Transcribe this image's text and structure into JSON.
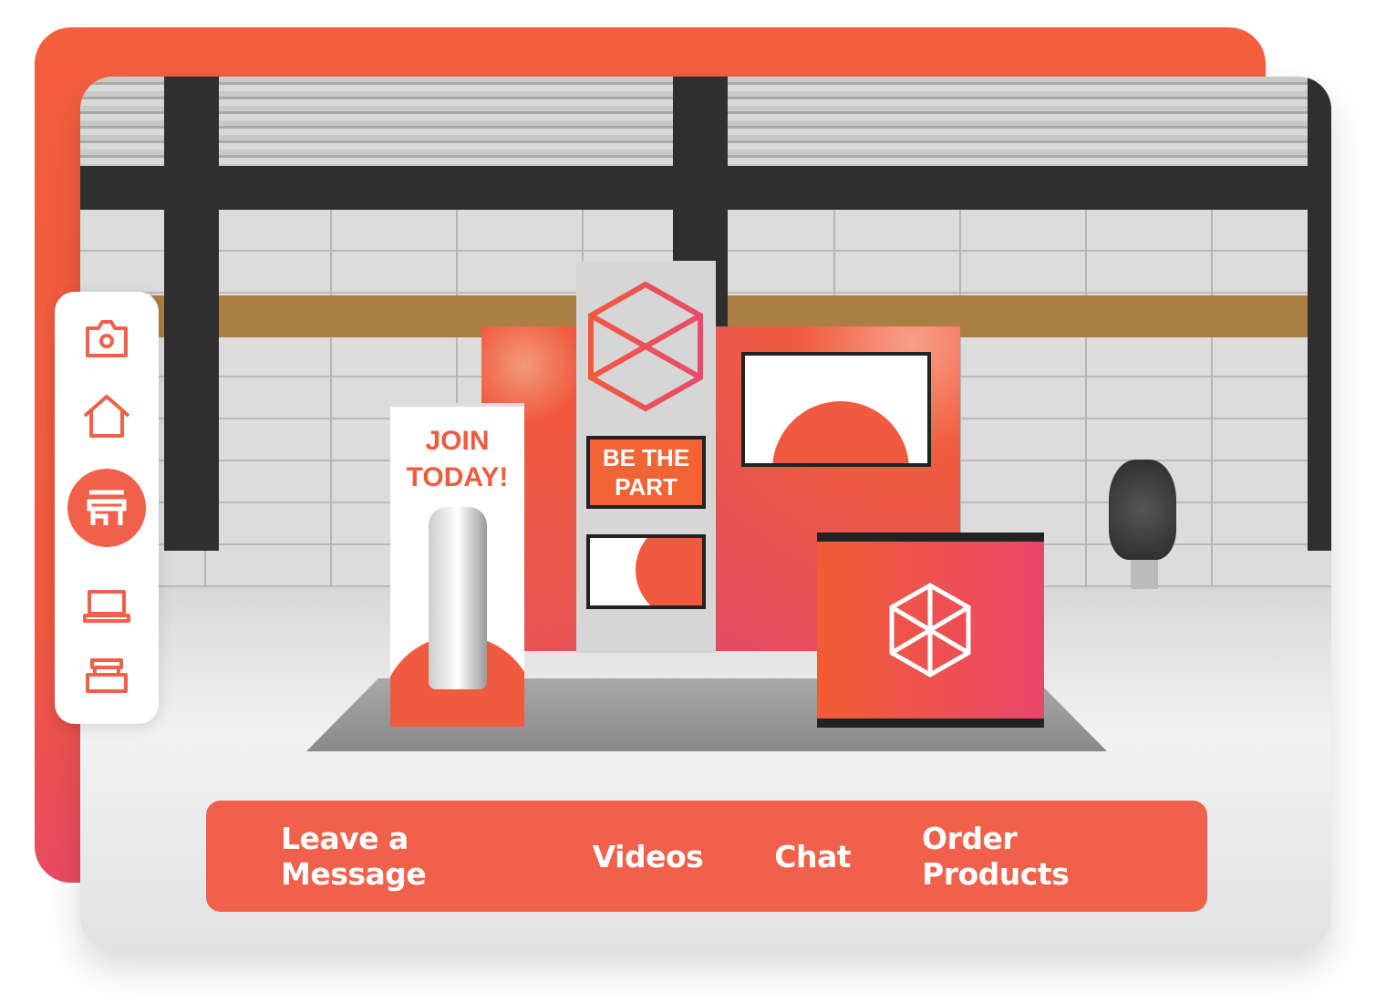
{
  "colors": {
    "accent": "#f0604a",
    "gradient_end": "#e94a63"
  },
  "sidebar": {
    "items": [
      {
        "icon": "camera-icon",
        "active": false
      },
      {
        "icon": "home-icon",
        "active": false
      },
      {
        "icon": "booth-store-icon",
        "active": true
      },
      {
        "icon": "laptop-icon",
        "active": false
      },
      {
        "icon": "kiosk-icon",
        "active": false
      }
    ]
  },
  "booth": {
    "banner_text": "JOIN TODAY!",
    "tower_text": "BE THE PART"
  },
  "actions": [
    {
      "label": "Leave a Message"
    },
    {
      "label": "Videos"
    },
    {
      "label": "Chat"
    },
    {
      "label": "Order Products"
    }
  ]
}
